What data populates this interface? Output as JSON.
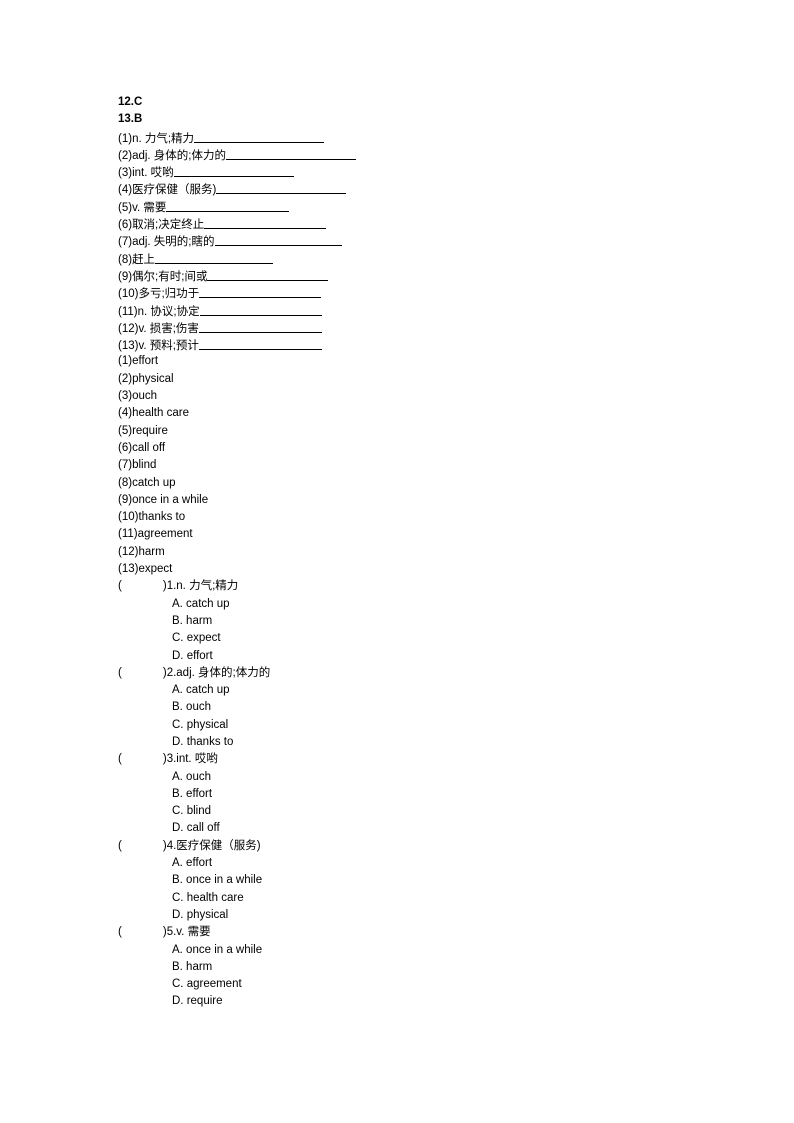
{
  "document": {
    "answer_letters": [
      {
        "number": "12.",
        "answer": "C"
      },
      {
        "number": "13.",
        "answer": "B"
      }
    ],
    "fill_in_blanks": [
      {
        "label": "(1)",
        "prompt": "n. 力气;精力",
        "blank_width": 130
      },
      {
        "label": "(2)",
        "prompt": "adj. 身体的;体力的",
        "blank_width": 130
      },
      {
        "label": "(3)",
        "prompt": "int. 哎哟",
        "blank_width": 120
      },
      {
        "label": "(4)",
        "prompt": "医疗保健（服务)",
        "blank_width": 130
      },
      {
        "label": "(5)",
        "prompt": "v. 需要",
        "blank_width": 123
      },
      {
        "label": "(6)",
        "prompt": "取消;决定终止",
        "blank_width": 122
      },
      {
        "label": "(7)",
        "prompt": "adj. 失明的;瞎的",
        "blank_width": 127
      },
      {
        "label": "(8)",
        "prompt": "赶上",
        "blank_width": 118
      },
      {
        "label": "(9)",
        "prompt": "偶尔;有时;间或",
        "blank_width": 121
      },
      {
        "label": "(10)",
        "prompt": "多亏;归功于",
        "blank_width": 122
      },
      {
        "label": "(11)",
        "prompt": "n. 协议;协定",
        "blank_width": 122
      },
      {
        "label": "(12)",
        "prompt": "v. 损害;伤害",
        "blank_width": 123
      },
      {
        "label": "(13)",
        "prompt": "v. 预料;预计",
        "blank_width": 123
      }
    ],
    "answer_words": [
      {
        "label": "(1)",
        "word": "effort"
      },
      {
        "label": "(2)",
        "word": "physical"
      },
      {
        "label": "(3)",
        "word": "ouch"
      },
      {
        "label": "(4)",
        "word": "health care"
      },
      {
        "label": "(5)",
        "word": "require"
      },
      {
        "label": "(6)",
        "word": "call off"
      },
      {
        "label": "(7)",
        "word": "blind"
      },
      {
        "label": "(8)",
        "word": "catch up"
      },
      {
        "label": "(9)",
        "word": "once in a while"
      },
      {
        "label": "(10)",
        "word": "thanks to"
      },
      {
        "label": "(11)",
        "word": "agreement"
      },
      {
        "label": "(12)",
        "word": "harm"
      },
      {
        "label": "(13)",
        "word": "expect"
      }
    ],
    "multiple_choice": [
      {
        "paren_open": "(",
        "paren_close": ")",
        "number": "1.",
        "stem": "n. 力气;精力",
        "options": [
          "A. catch up",
          "B. harm",
          "C. expect",
          "D. effort"
        ]
      },
      {
        "paren_open": "(",
        "paren_close": ")",
        "number": "2.",
        "stem": "adj. 身体的;体力的",
        "options": [
          "A. catch up",
          "B. ouch",
          "C. physical",
          "D. thanks to"
        ]
      },
      {
        "paren_open": "(",
        "paren_close": ")",
        "number": "3.",
        "stem": "int. 哎哟",
        "options": [
          "A. ouch",
          "B. effort",
          "C. blind",
          "D. call off"
        ]
      },
      {
        "paren_open": "(",
        "paren_close": ")",
        "number": "4.",
        "stem": "医疗保健（服务)",
        "options": [
          "A. effort",
          "B. once in a while",
          "C. health care",
          "D. physical"
        ]
      },
      {
        "paren_open": "(",
        "paren_close": ")",
        "number": "5.",
        "stem": "v. 需要",
        "options": [
          "A. once in a while",
          "B. harm",
          "C. agreement",
          "D. require"
        ]
      }
    ]
  }
}
